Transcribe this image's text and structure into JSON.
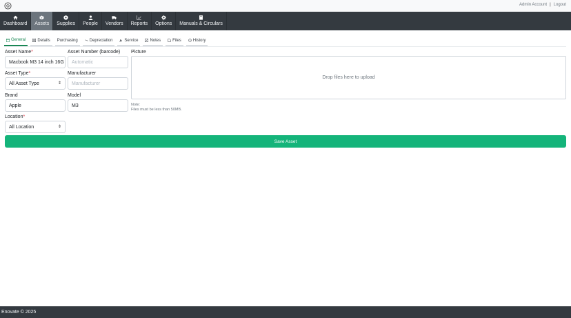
{
  "topbar": {
    "account_link": "Admin Account",
    "separator": "|",
    "logout_link": "Logout"
  },
  "nav": {
    "items": [
      {
        "label": "Dashboard",
        "icon": "home-icon"
      },
      {
        "label": "Assets",
        "icon": "box-icon",
        "active": true
      },
      {
        "label": "Supplies",
        "icon": "supplies-icon"
      },
      {
        "label": "People",
        "icon": "person-icon"
      },
      {
        "label": "Vendors",
        "icon": "truck-icon"
      },
      {
        "label": "Reports",
        "icon": "chart-icon"
      },
      {
        "label": "Options",
        "icon": "gear-icon"
      },
      {
        "label": "Manuals & Circulars",
        "icon": "book-icon"
      }
    ]
  },
  "tabs": [
    {
      "label": "General",
      "icon": "general-icon",
      "active": true
    },
    {
      "label": "Details",
      "icon": "details-icon"
    },
    {
      "label": "Purchasing",
      "icon": ""
    },
    {
      "label": "Depreciation",
      "icon": "depreciation-icon"
    },
    {
      "label": "Service",
      "icon": "wrench-icon"
    },
    {
      "label": "Notes",
      "icon": "notes-icon"
    },
    {
      "label": "Files",
      "icon": "file-icon"
    },
    {
      "label": "History",
      "icon": "clock-icon"
    }
  ],
  "form": {
    "asset_name": {
      "label": "Asset Name",
      "required_mark": "*",
      "value": "Macbook M3 14 inch 16G"
    },
    "asset_number": {
      "label": "Asset Number (barcode)",
      "placeholder": "Automatic"
    },
    "asset_type": {
      "label": "Asset Type",
      "required_mark": "*",
      "value": "All Asset Type"
    },
    "manufacturer": {
      "label": "Manufacturer",
      "placeholder": "Manufacturer"
    },
    "brand": {
      "label": "Brand",
      "value": "Apple"
    },
    "model": {
      "label": "Model",
      "value": "M3"
    },
    "location": {
      "label": "Location",
      "required_mark": "*",
      "value": "All Location"
    },
    "picture": {
      "label": "Picture",
      "dropzone_text": "Drop files here to upload",
      "note_title": "Note:",
      "note_text": "Files must be less than 50MB."
    },
    "save_button": "Save Asset"
  },
  "footer": {
    "text": "Enovate © 2025"
  },
  "colors": {
    "nav_bg": "#343a40",
    "nav_active": "#6c757d",
    "accent": "#198754",
    "save_button": "#14b47a",
    "required": "#dc3545"
  }
}
